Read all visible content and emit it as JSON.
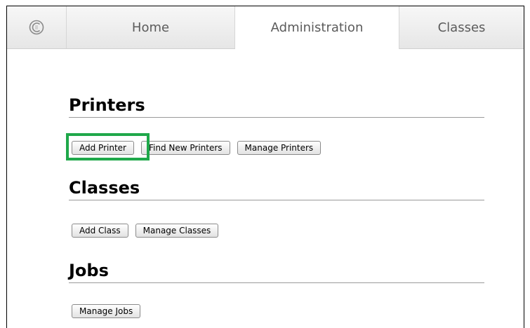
{
  "tabs": {
    "logo_icon": "cups-logo-icon",
    "home": "Home",
    "administration": "Administration",
    "classes": "Classes"
  },
  "printers": {
    "heading": "Printers",
    "buttons": {
      "add": "Add Printer",
      "find": "Find New Printers",
      "manage": "Manage Printers"
    }
  },
  "classes_section": {
    "heading": "Classes",
    "buttons": {
      "add": "Add Class",
      "manage": "Manage Classes"
    }
  },
  "jobs": {
    "heading": "Jobs",
    "buttons": {
      "manage": "Manage Jobs"
    }
  },
  "colors": {
    "highlight": "#1fa84a",
    "tab_text": "#5b5b5b"
  }
}
